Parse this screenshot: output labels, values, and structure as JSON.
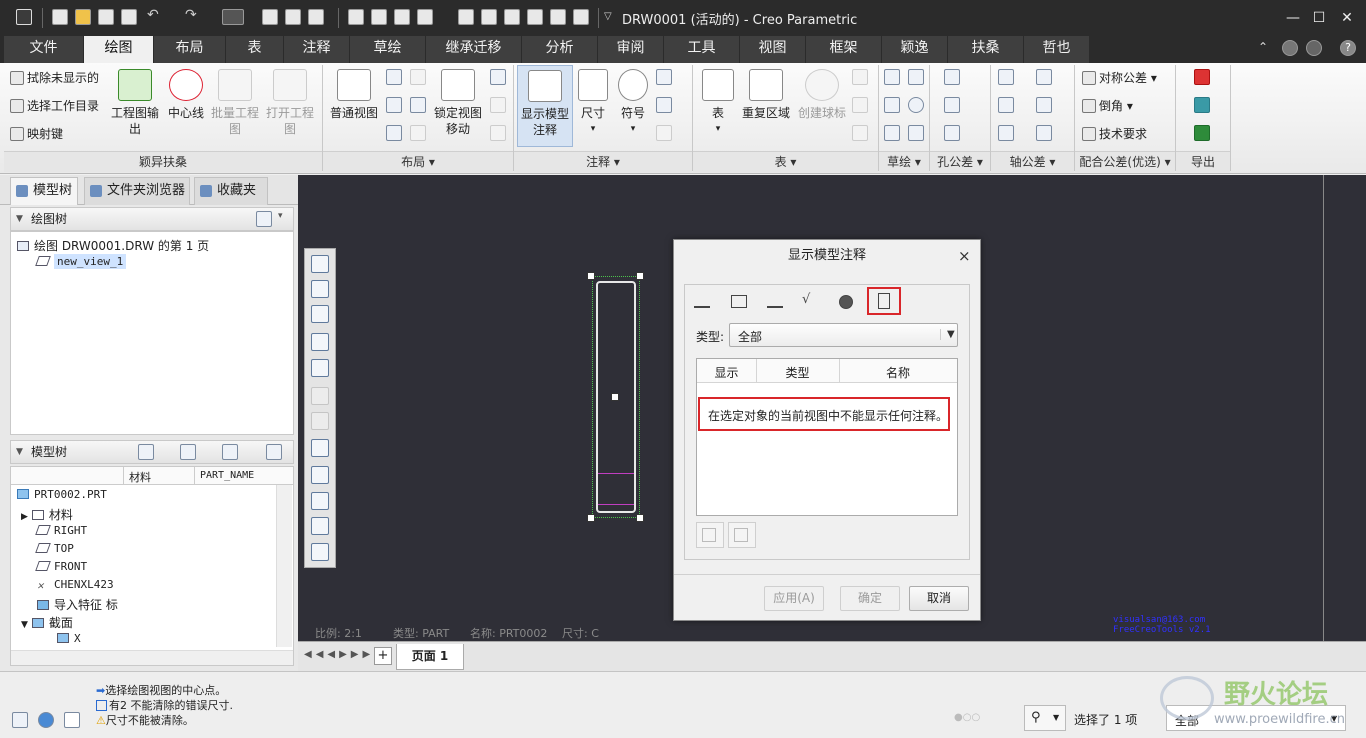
{
  "window": {
    "title": "DRW0001 (活动的) - Creo Parametric",
    "minimize": "—",
    "maximize": "☐",
    "close": "✕"
  },
  "tabs": [
    "文件",
    "绘图",
    "布局",
    "表",
    "注释",
    "草绘",
    "继承迁移",
    "分析",
    "审阅",
    "工具",
    "视图",
    "框架",
    "颖逸",
    "扶桑",
    "哲也"
  ],
  "ribbon": {
    "yingyi": {
      "clear_undisplayed": "拭除未显示的",
      "select_workdir": "选择工作目录",
      "mapkey": "映射键",
      "drawing_output": "工程图输出",
      "centerline": "中心线",
      "batch_drawing": "批量工程图",
      "open_drawing": "打开工程图",
      "label": "颖异扶桑"
    },
    "layout": {
      "general_view": "普通视图",
      "lock_view_move": "锁定视图移动",
      "label": "布局"
    },
    "annotate": {
      "show_model_annotations": "显示模型注释",
      "dimension": "尺寸",
      "symbol": "符号",
      "label": "注释"
    },
    "table": {
      "table": "表",
      "repeat_region": "重复区域",
      "create_balloon": "创建球标",
      "label": "表"
    },
    "sketch_label": "草绘",
    "hole_tol_label": "孔公差",
    "shaft_tol_label": "轴公差",
    "fit_tol": {
      "symmetric_tol": "对称公差",
      "chamfer": "倒角",
      "tech_req": "技术要求",
      "label": "配合公差(优选)"
    },
    "export_label": "导出"
  },
  "left_panel": {
    "tabs": [
      "模型树",
      "文件夹浏览器",
      "收藏夹"
    ],
    "drawing_tree": {
      "header": "绘图树",
      "root": "绘图 DRW0001.DRW 的第 1 页",
      "view": "new_view_1"
    },
    "model_tree": {
      "header": "模型树",
      "columns": [
        "材料",
        "PART_NAME"
      ],
      "items": [
        "PRT0002.PRT",
        "材料",
        "RIGHT",
        "TOP",
        "FRONT",
        "CHENXL423",
        "导入特征 标",
        "截面",
        "X"
      ]
    }
  },
  "canvas": {
    "status": {
      "scale": "比例: 2:1",
      "type": "类型: PART",
      "name": "名称: PRT0002",
      "size": "尺寸: C"
    },
    "watermark_line1": "visualsan@163.com",
    "watermark_line2": "FreeCreoTools v2.1"
  },
  "dialog": {
    "title": "显示模型注释",
    "close": "×",
    "type_label": "类型:",
    "type_value": "全部",
    "columns": [
      "显示",
      "类型",
      "名称"
    ],
    "message": "在选定对象的当前视图中不能显示任何注释。",
    "apply": "应用(A)",
    "ok": "确定",
    "cancel": "取消"
  },
  "pagebar": {
    "add": "+",
    "page": "页面 1"
  },
  "statusbar": {
    "messages": [
      "选择绘图视图的中心点。",
      "有2 不能清除的错误尺寸.",
      "尺寸不能被清除。"
    ],
    "selected": "选择了 1 项",
    "filter": "全部"
  },
  "logo": {
    "text": "野火论坛",
    "url": "www.proewildfire.cn"
  },
  "colors": {
    "accent_red": "#d9262a",
    "selection_blue": "#cfe3ff",
    "canvas_bg": "#2f2f37",
    "part_magenta": "#c03ec0"
  }
}
